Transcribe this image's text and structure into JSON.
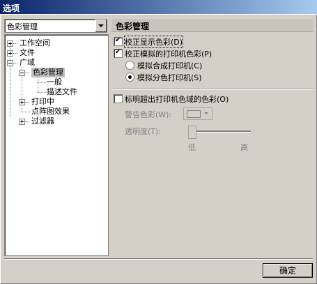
{
  "window": {
    "title": "选项"
  },
  "combo": {
    "value": "色彩管理"
  },
  "tree": {
    "workspace": "工作空间",
    "files": "文件",
    "general": "广域",
    "color_mgmt": "色彩管理",
    "general_sub": "一般",
    "profiles": "描述文件",
    "printing": "打印中",
    "bitmap": "点阵图效果",
    "filters": "过滤器"
  },
  "panel": {
    "header": "色彩管理",
    "calibrate_display": "校正显示色彩(D)",
    "calibrate_printer": "校正模拟的打印机色彩(P)",
    "sim_composite": "模拟合成打印机(C)",
    "sim_separation": "模拟分色打印机(S)",
    "mark_out_of_gamut": "标明超出打印机色域的色彩(O)",
    "warning_color": "警告色彩(W):",
    "transparency": "透明度(T):",
    "low": "低",
    "high": "高"
  },
  "buttons": {
    "ok": "确定"
  },
  "states": {
    "calibrate_display": true,
    "calibrate_printer": true,
    "sim_composite": false,
    "sim_separation": true,
    "mark_out_of_gamut": false
  }
}
